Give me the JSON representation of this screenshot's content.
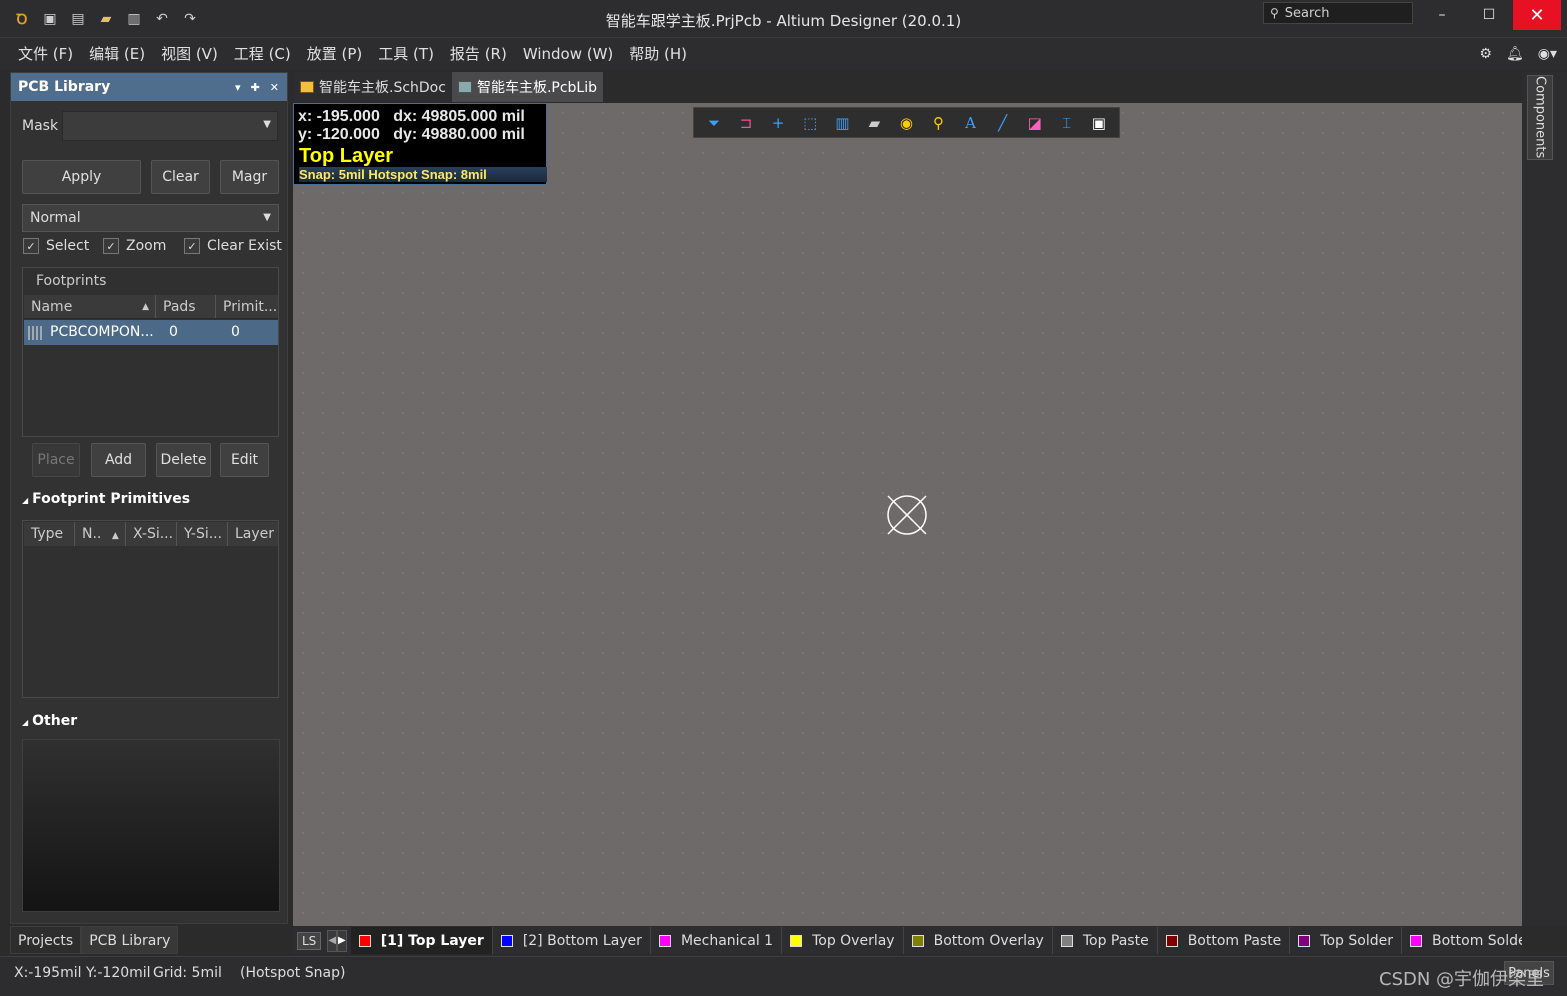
{
  "app": {
    "title": "智能车跟学主板.PrjPcb - Altium Designer (20.0.1)",
    "search_placeholder": "Search"
  },
  "menu": [
    "文件 (F)",
    "编辑 (E)",
    "视图 (V)",
    "工程 (C)",
    "放置 (P)",
    "工具 (T)",
    "报告 (R)",
    "Window (W)",
    "帮助 (H)"
  ],
  "panel": {
    "title": "PCB Library",
    "mask_label": "Mask",
    "mask_value": "",
    "apply": "Apply",
    "clear": "Clear",
    "magnify": "Magr",
    "mode": "Normal",
    "select": "Select",
    "zoom": "Zoom",
    "clear_existing": "Clear Exist",
    "footprints_label": "Footprints",
    "fp_columns": [
      "Name",
      "Pads",
      "Primit..."
    ],
    "fp_row": {
      "name": "PCBCOMPON...",
      "pads": "0",
      "primitives": "0"
    },
    "place": "Place",
    "add": "Add",
    "delete": "Delete",
    "edit": "Edit",
    "primitives_title": "Footprint Primitives",
    "prim_columns": [
      "Type",
      "N..",
      "X-Si...",
      "Y-Si...",
      "Layer"
    ],
    "other_title": "Other"
  },
  "panel_tabs": [
    "Projects",
    "PCB Library"
  ],
  "doc_tabs": [
    "智能车主板.SchDoc",
    "智能车主板.PcbLib"
  ],
  "hud": {
    "x": "x:  -195.000",
    "dx": "dx: 49805.000 mil",
    "y": "y:  -120.000",
    "dy": "dy: 49880.000 mil",
    "layer": "Top Layer",
    "snap": "Snap: 5mil Hotspot Snap: 8mil"
  },
  "toolbar_icons": [
    "filter-icon",
    "route-icon",
    "cross-icon",
    "select-rect-icon",
    "align-icon",
    "component-icon",
    "pad-icon",
    "via-icon",
    "text-icon",
    "line-icon",
    "region-icon",
    "dimension-icon",
    "fill-icon"
  ],
  "right_tab": "Components",
  "layer_bar": {
    "ls": "LS",
    "layers": [
      {
        "label": "[1] Top Layer",
        "color": "#ff0000",
        "active": true
      },
      {
        "label": "[2] Bottom Layer",
        "color": "#0000ff",
        "active": false
      },
      {
        "label": "Mechanical 1",
        "color": "#ff00ff",
        "active": false
      },
      {
        "label": "Top Overlay",
        "color": "#ffff00",
        "active": false
      },
      {
        "label": "Bottom Overlay",
        "color": "#808000",
        "active": false
      },
      {
        "label": "Top Paste",
        "color": "#808080",
        "active": false
      },
      {
        "label": "Bottom Paste",
        "color": "#800000",
        "active": false
      },
      {
        "label": "Top Solder",
        "color": "#800080",
        "active": false
      },
      {
        "label": "Bottom Solder",
        "color": "#ff00ff",
        "active": false
      }
    ]
  },
  "status": {
    "coords": "X:-195mil Y:-120mil",
    "grid": "Grid: 5mil",
    "snap": "(Hotspot Snap)",
    "panels": "Panels"
  },
  "watermark": "CSDN @宇伽伊梁里"
}
